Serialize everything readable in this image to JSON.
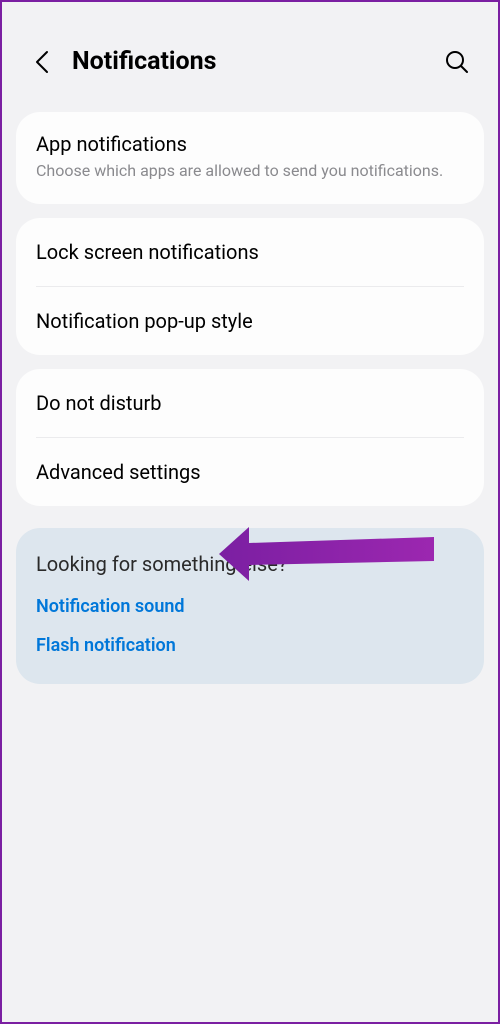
{
  "header": {
    "title": "Notifications"
  },
  "sections": {
    "app_notifications": {
      "title": "App notifications",
      "subtitle": "Choose which apps are allowed to send you notifications."
    },
    "lock_screen": {
      "title": "Lock screen notifications"
    },
    "popup_style": {
      "title": "Notification pop-up style"
    },
    "dnd": {
      "title": "Do not disturb"
    },
    "advanced": {
      "title": "Advanced settings"
    }
  },
  "looking_for": {
    "title": "Looking for something else?",
    "links": {
      "sound": "Notification sound",
      "flash": "Flash notification"
    }
  }
}
